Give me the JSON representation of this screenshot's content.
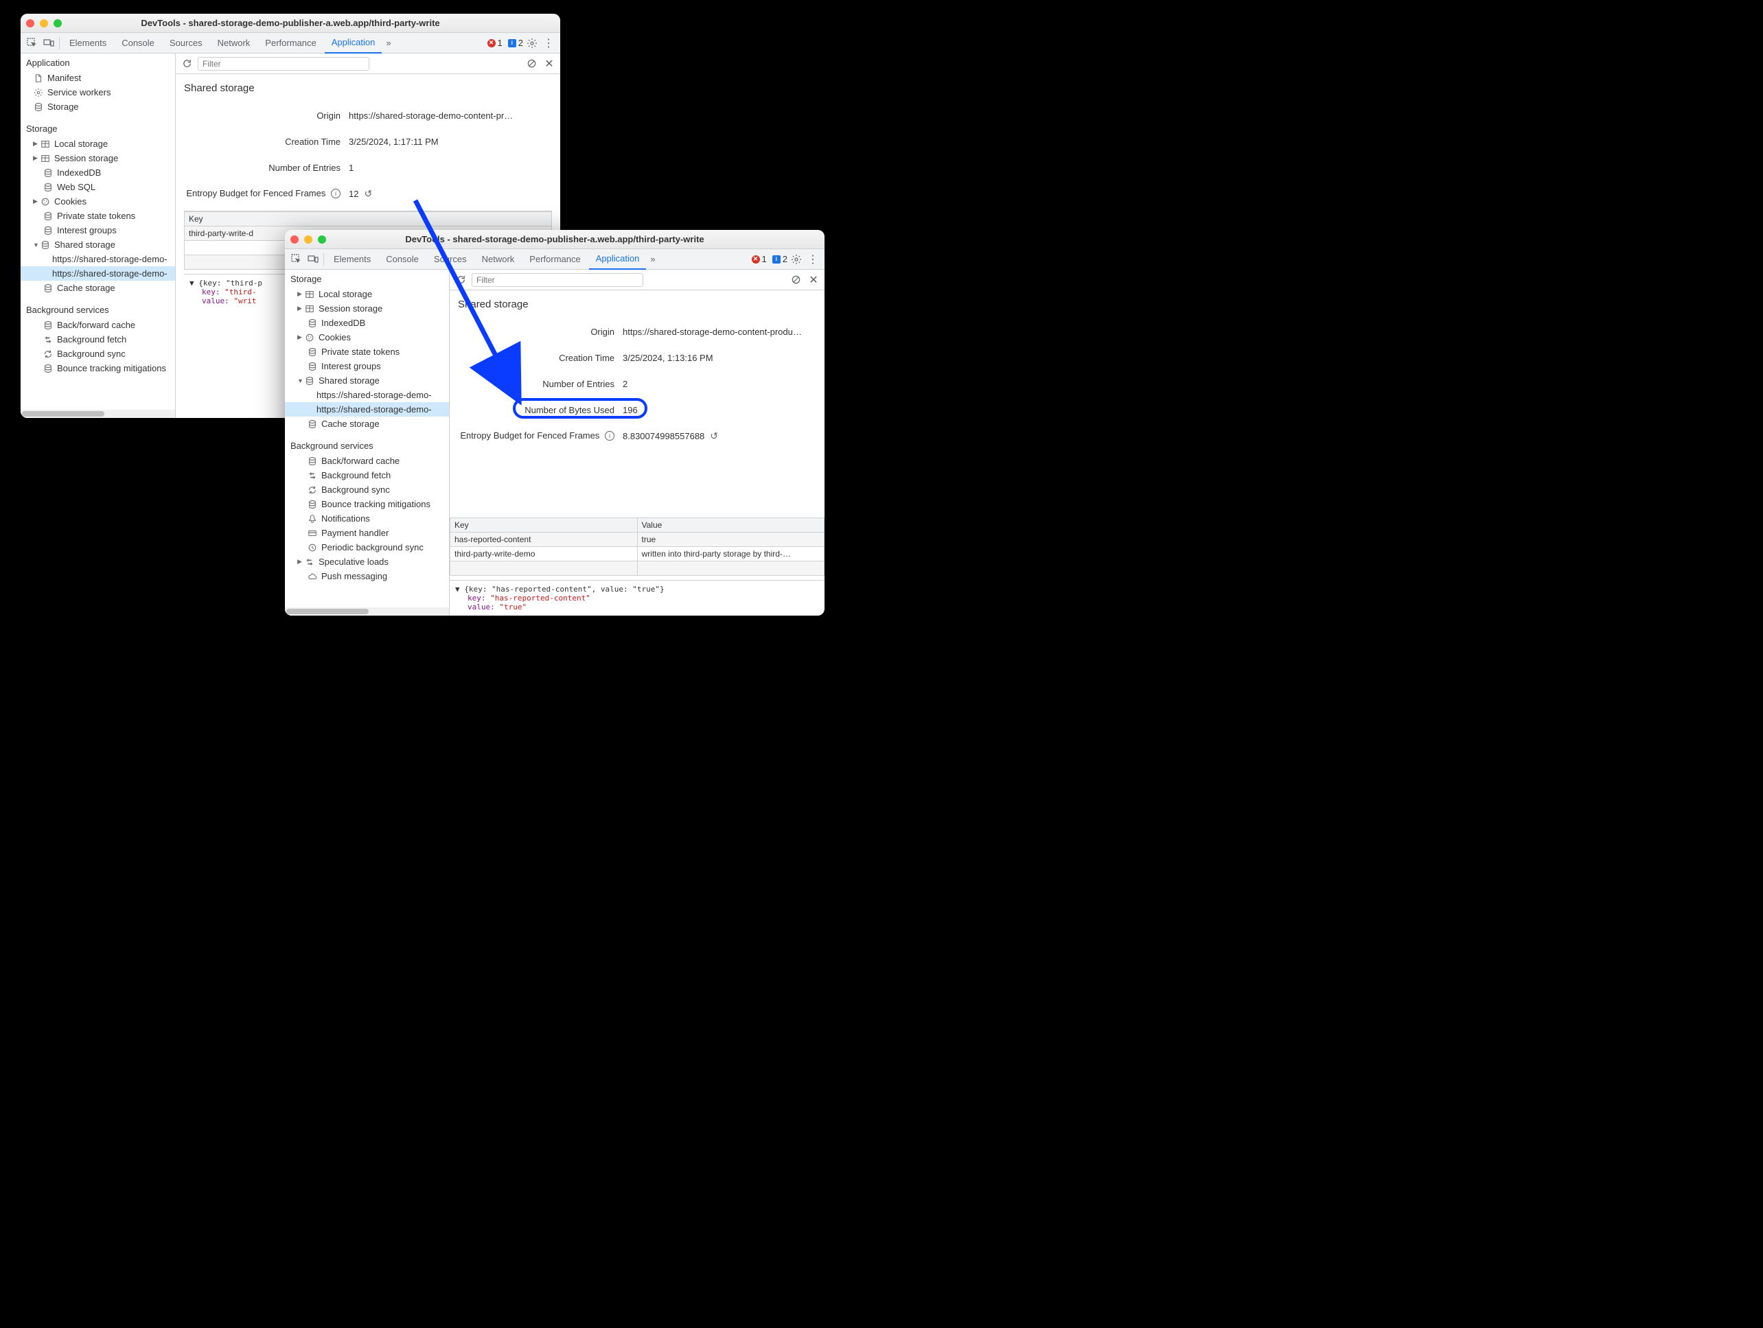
{
  "title": "DevTools - shared-storage-demo-publisher-a.web.app/third-party-write",
  "tabs": [
    "Elements",
    "Console",
    "Sources",
    "Network",
    "Performance",
    "Application"
  ],
  "errors": "1",
  "infos": "2",
  "filter_placeholder": "Filter",
  "sidebarA": {
    "application_h": "Application",
    "manifest": "Manifest",
    "service_workers": "Service workers",
    "storage": "Storage",
    "storage_h": "Storage",
    "local_storage": "Local storage",
    "session_storage": "Session storage",
    "indexeddb": "IndexedDB",
    "websql": "Web SQL",
    "cookies": "Cookies",
    "pst": "Private state tokens",
    "ig": "Interest groups",
    "shared_storage": "Shared storage",
    "ss_origin1": "https://shared-storage-demo-",
    "ss_origin2": "https://shared-storage-demo-",
    "cache_storage": "Cache storage",
    "bgservices_h": "Background services",
    "bfcache": "Back/forward cache",
    "bgfetch": "Background fetch",
    "bgsync": "Background sync",
    "btm": "Bounce tracking mitigations"
  },
  "panelA": {
    "heading": "Shared storage",
    "origin_k": "Origin",
    "origin_v": "https://shared-storage-demo-content-pr…",
    "ctime_k": "Creation Time",
    "ctime_v": "3/25/2024, 1:17:11 PM",
    "entries_k": "Number of Entries",
    "entries_v": "1",
    "budget_k": "Entropy Budget for Fenced Frames",
    "budget_v": "12",
    "table_key_h": "Key",
    "row1_key": "third-party-write-d",
    "detail_open": "▼ {key: \"third-p",
    "detail_k": "key:",
    "detail_kv": "\"third-",
    "detail_vk": "value:",
    "detail_vv": "\"writ"
  },
  "sidebarB": {
    "storage_h": "Storage",
    "local_storage": "Local storage",
    "session_storage": "Session storage",
    "indexeddb": "IndexedDB",
    "cookies": "Cookies",
    "pst": "Private state tokens",
    "ig": "Interest groups",
    "shared_storage": "Shared storage",
    "ss_origin1": "https://shared-storage-demo-",
    "ss_origin2": "https://shared-storage-demo-",
    "cache_storage": "Cache storage",
    "bgservices_h": "Background services",
    "bfcache": "Back/forward cache",
    "bgfetch": "Background fetch",
    "bgsync": "Background sync",
    "btm": "Bounce tracking mitigations",
    "notifications": "Notifications",
    "payment": "Payment handler",
    "periodic": "Periodic background sync",
    "speculative": "Speculative loads",
    "push": "Push messaging"
  },
  "panelB": {
    "heading": "Shared storage",
    "origin_k": "Origin",
    "origin_v": "https://shared-storage-demo-content-produ…",
    "ctime_k": "Creation Time",
    "ctime_v": "3/25/2024, 1:13:16 PM",
    "entries_k": "Number of Entries",
    "entries_v": "2",
    "bytes_k": "Number of Bytes Used",
    "bytes_v": "196",
    "budget_k": "Entropy Budget for Fenced Frames",
    "budget_v": "8.830074998557688",
    "table_key_h": "Key",
    "table_val_h": "Value",
    "row1_key": "has-reported-content",
    "row1_val": "true",
    "row2_key": "third-party-write-demo",
    "row2_val": "written into third-party storage by third-…",
    "detail_open": "▼ {key: \"has-reported-content\", value: \"true\"}",
    "detail_k": "key:",
    "detail_kv": "\"has-reported-content\"",
    "detail_vk": "value:",
    "detail_vv": "\"true\""
  }
}
